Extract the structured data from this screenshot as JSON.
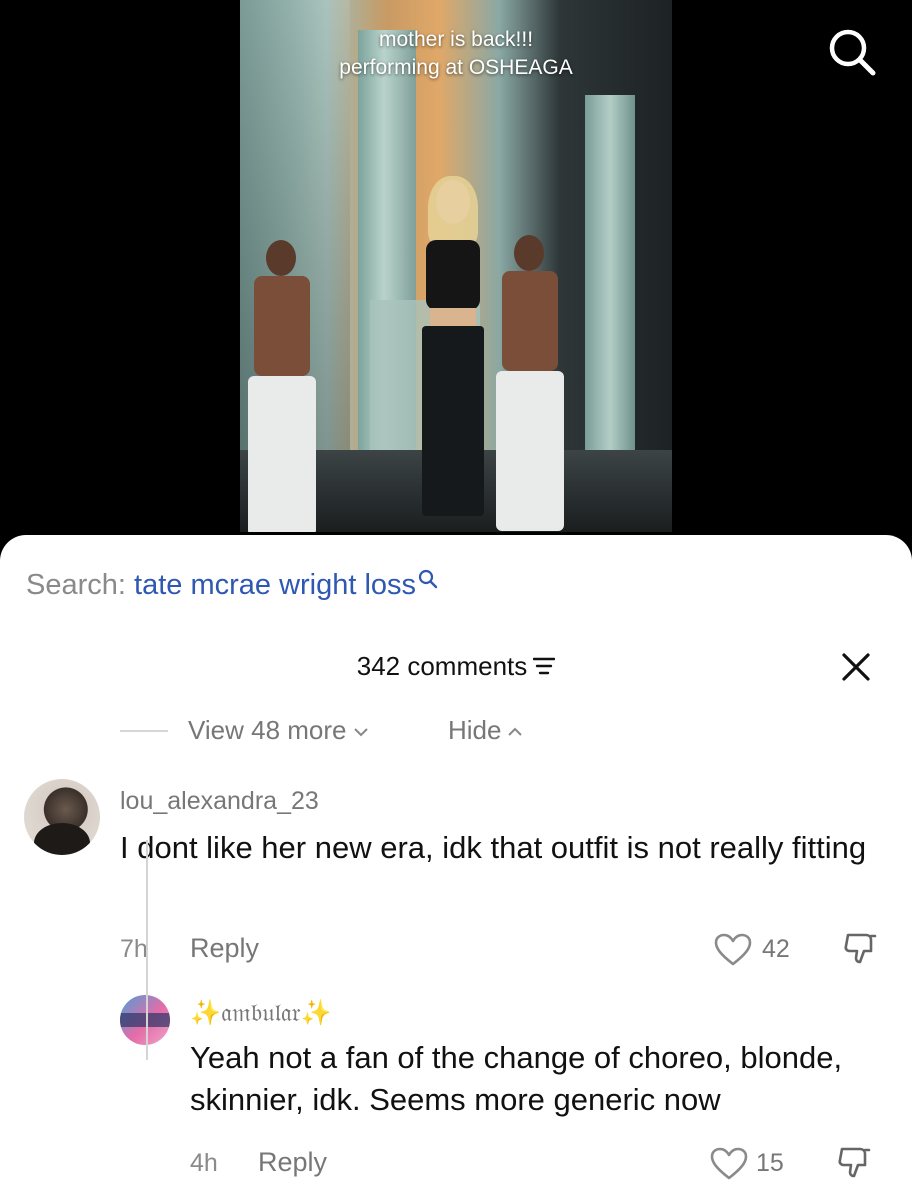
{
  "video": {
    "caption_line1": "mother is back!!!",
    "caption_line2": "performing at OSHEAGA",
    "search_icon": "search-icon"
  },
  "search": {
    "label": "Search:",
    "query": "tate mcrae wright loss",
    "icon": "search-small-icon",
    "query_color": "#2f58b3"
  },
  "comments_panel": {
    "count_label": "342 comments",
    "filter_icon": "filter-icon",
    "close_icon": "close-icon",
    "view_more_label": "View 48 more",
    "hide_label": "Hide"
  },
  "comments": [
    {
      "username": "lou_alexandra_23",
      "text": "I dont like her new era, idk that outfit is not really fitting",
      "time": "7h",
      "reply_label": "Reply",
      "likes": "42"
    },
    {
      "username": "𝔞𝔪𝔟𝔲𝔩𝔞𝔯",
      "username_decoration": "✨",
      "text": "Yeah not a fan of the change of choreo, blonde, skinnier, idk. Seems more generic now",
      "time": "4h",
      "reply_label": "Reply",
      "likes": "15"
    }
  ]
}
